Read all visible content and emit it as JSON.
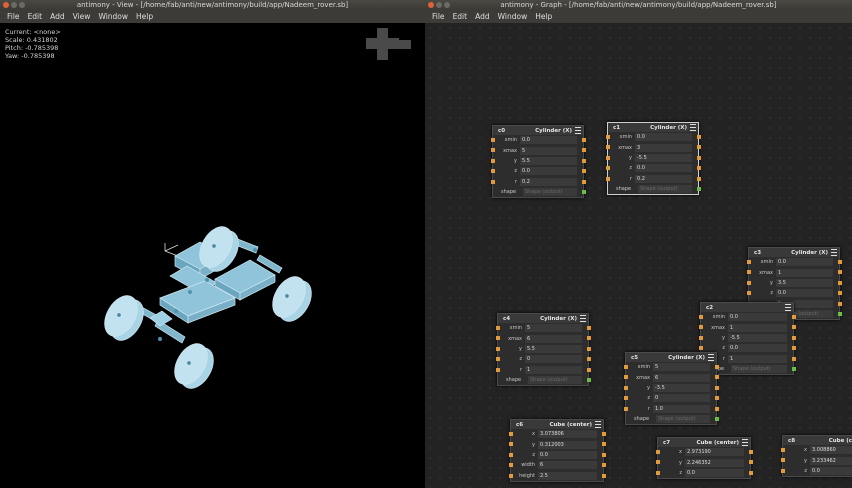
{
  "view_window": {
    "title": "antimony - View - [/home/fab/anti/new/antimony/build/app/Nadeem_rover.sb]",
    "menu": [
      "File",
      "Edit",
      "Add",
      "View",
      "Window",
      "Help"
    ],
    "hud": {
      "current": "Current: <none>",
      "scale": "Scale: 0.431802",
      "pitch": "Pitch: -0.785398",
      "yaw": "Yaw: -0.785398"
    }
  },
  "graph_window": {
    "title": "antimony - Graph - [/home/fab/anti/new/antimony/build/app/Nadeem_rover.sb]",
    "menu": [
      "File",
      "Edit",
      "Add",
      "Window",
      "Help"
    ],
    "nodes": [
      {
        "id": "c0",
        "type": "Cylinder (X)",
        "selected": false,
        "rows": [
          [
            "xmin",
            "0.0"
          ],
          [
            "xmax",
            "5"
          ],
          [
            "y",
            "5.5"
          ],
          [
            "z",
            "0.0"
          ],
          [
            "r",
            "0.2"
          ]
        ],
        "shape": "Shape (output)"
      },
      {
        "id": "c1",
        "type": "Cylinder (X)",
        "selected": true,
        "rows": [
          [
            "xmin",
            "0.0"
          ],
          [
            "xmax",
            "3"
          ],
          [
            "y",
            "-5.5"
          ],
          [
            "z",
            "0.0"
          ],
          [
            "r",
            "0.2"
          ]
        ],
        "shape": "Shape (output)"
      },
      {
        "id": "c3",
        "type": "Cylinder (X)",
        "selected": false,
        "rows": [
          [
            "xmin",
            "0.0"
          ],
          [
            "xmax",
            "1"
          ],
          [
            "y",
            "3.5"
          ],
          [
            "z",
            "0.0"
          ],
          [
            "r",
            "1"
          ]
        ],
        "shape": "Shape (output)"
      },
      {
        "id": "c2",
        "type": "",
        "selected": false,
        "rows": [
          [
            "xmin",
            "0.0"
          ],
          [
            "xmax",
            "1"
          ],
          [
            "y",
            "-5.5"
          ],
          [
            "z",
            "0.0"
          ],
          [
            "r",
            "1"
          ]
        ],
        "shape": "Shape (output)"
      },
      {
        "id": "c4",
        "type": "Cylinder (X)",
        "selected": false,
        "rows": [
          [
            "xmin",
            "5"
          ],
          [
            "xmax",
            "6"
          ],
          [
            "y",
            "5.5"
          ],
          [
            "z",
            "0"
          ],
          [
            "r",
            "1"
          ]
        ],
        "shape": "Shape (output)"
      },
      {
        "id": "c5",
        "type": "Cylinder (X)",
        "selected": false,
        "rows": [
          [
            "xmin",
            "5"
          ],
          [
            "xmax",
            "6"
          ],
          [
            "y",
            "-3.5"
          ],
          [
            "z",
            "0"
          ],
          [
            "r",
            "1.0"
          ]
        ],
        "shape": "Shape (output)"
      },
      {
        "id": "c6",
        "type": "Cube (center)",
        "selected": false,
        "rows": [
          [
            "x",
            "3.073806"
          ],
          [
            "y",
            "0.312003"
          ],
          [
            "z",
            "0.0"
          ],
          [
            "width",
            "6"
          ],
          [
            "height",
            "2.5"
          ]
        ],
        "shape": ""
      },
      {
        "id": "c7",
        "type": "Cube (center)",
        "selected": false,
        "rows": [
          [
            "x",
            "2.973190"
          ],
          [
            "y",
            "2.246352"
          ],
          [
            "z",
            "0.0"
          ]
        ],
        "shape": ""
      },
      {
        "id": "c8",
        "type": "Cube (c",
        "selected": false,
        "rows": [
          [
            "x",
            "3.008860"
          ],
          [
            "y",
            "3.233462"
          ],
          [
            "z",
            "0.0"
          ]
        ],
        "shape": ""
      }
    ]
  }
}
